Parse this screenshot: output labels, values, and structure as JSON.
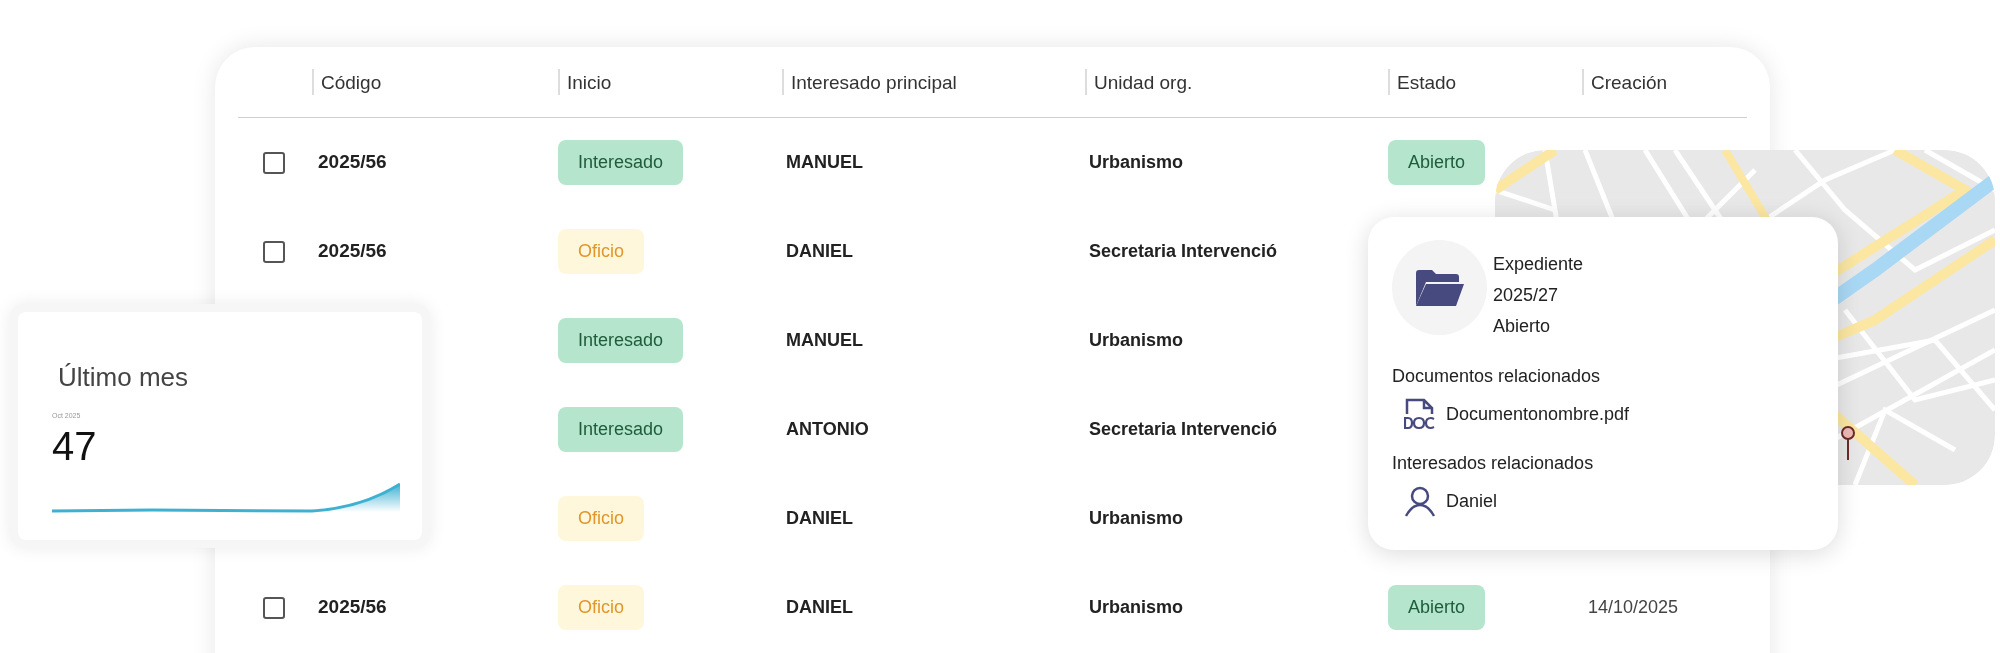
{
  "table": {
    "columns": [
      "Código",
      "Inicio",
      "Interesado principal",
      "Unidad org.",
      "Estado",
      "Creación"
    ],
    "rows": [
      {
        "checked": false,
        "code": "2025/56",
        "inicio": {
          "label": "Interesado",
          "kind": "interesado"
        },
        "interesado": "MANUEL",
        "unidad": "Urbanismo",
        "estado": "Abierto"
      },
      {
        "checked": false,
        "code": "2025/56",
        "inicio": {
          "label": "Oficio",
          "kind": "oficio"
        },
        "interesado": "DANIEL",
        "unidad": "Secretaria Intervenció"
      },
      {
        "inicio": {
          "label": "Interesado",
          "kind": "interesado"
        },
        "interesado": "MANUEL",
        "unidad": "Urbanismo"
      },
      {
        "inicio": {
          "label": "Interesado",
          "kind": "interesado"
        },
        "interesado": "ANTONIO",
        "unidad": "Secretaria Intervenció"
      },
      {
        "inicio": {
          "label": "Oficio",
          "kind": "oficio"
        },
        "interesado": "DANIEL",
        "unidad": "Urbanismo"
      },
      {
        "checked": false,
        "code": "2025/56",
        "inicio": {
          "label": "Oficio",
          "kind": "oficio"
        },
        "interesado": "DANIEL",
        "unidad": "Urbanismo",
        "estado": "Abierto",
        "creacion": "14/10/2025"
      }
    ]
  },
  "stats": {
    "title": "Último mes",
    "period": "Oct 2025",
    "value": "47"
  },
  "popup": {
    "lines": [
      "Expediente",
      "2025/27",
      "Abierto"
    ],
    "documents_title": "Documentos relacionados",
    "documents": [
      "Documentonombre.pdf"
    ],
    "people_title": "Interesados relacionados",
    "people": [
      "Daniel"
    ]
  }
}
